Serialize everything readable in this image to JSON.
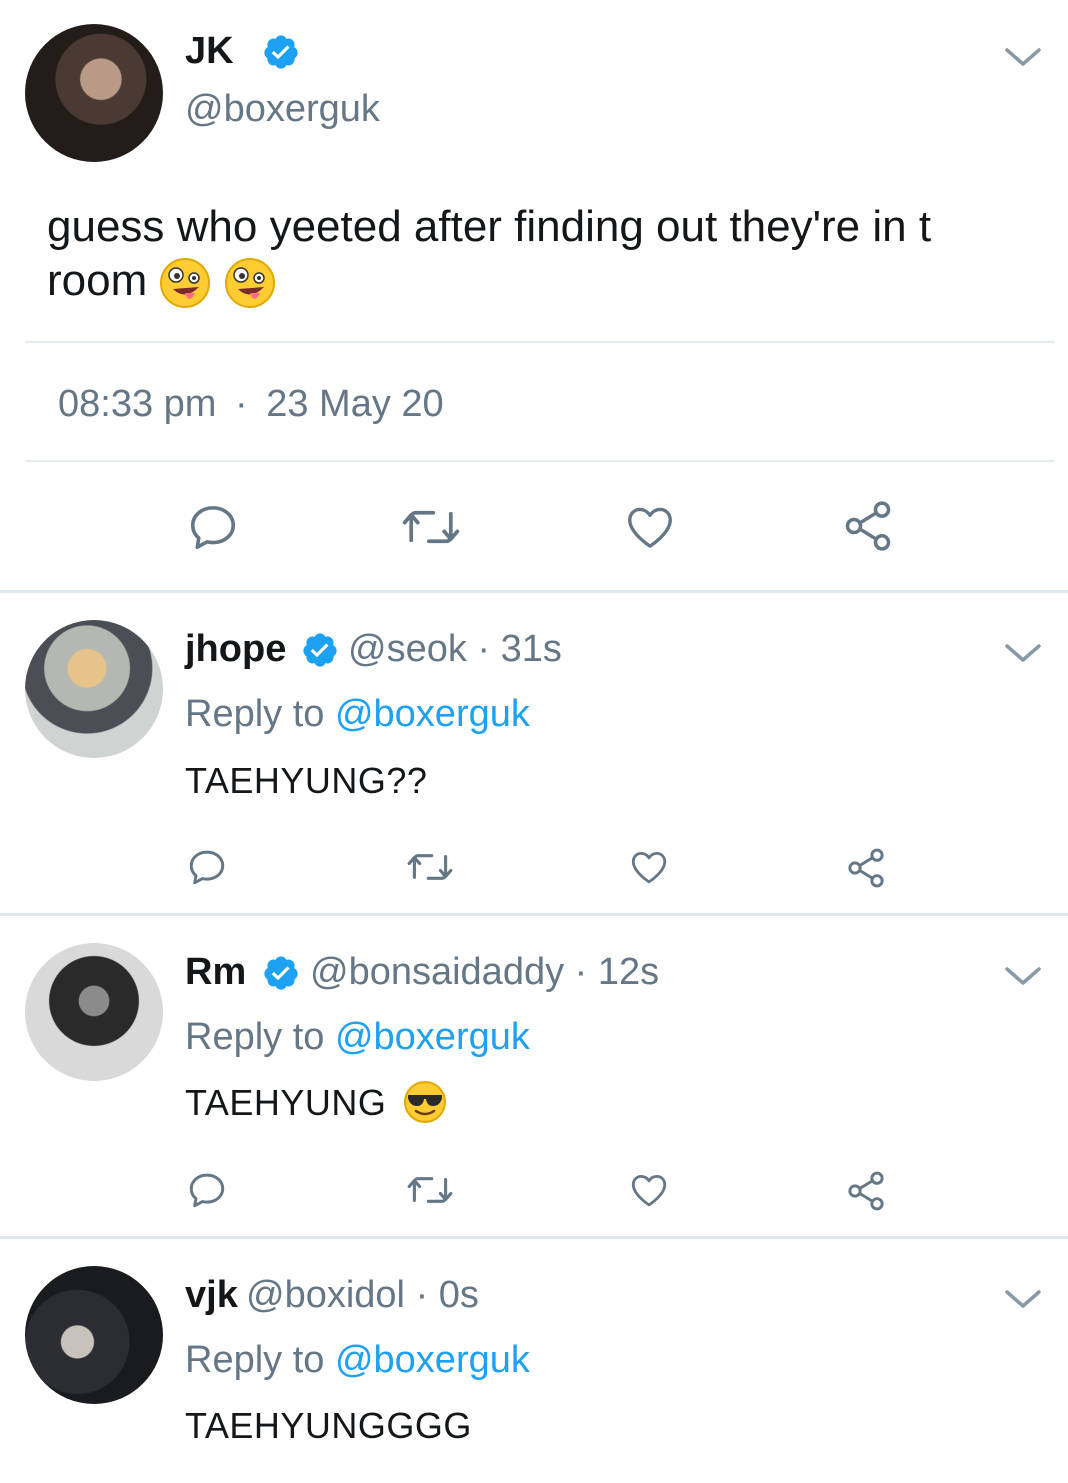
{
  "main_tweet": {
    "name": "JK",
    "handle": "@boxerguk",
    "text": "guess who yeeted after finding out they're in t room",
    "time": "08:33 pm",
    "separator": "·",
    "date": "23 May 20",
    "emojis": [
      "zany-face-emoji",
      "zany-face-emoji"
    ]
  },
  "replies": [
    {
      "name": "jhope",
      "verified": true,
      "handle": "@seok",
      "time": "· 31s",
      "reply_prefix": "Reply to ",
      "reply_target": "@boxerguk",
      "text": "TAEHYUNG??"
    },
    {
      "name": "Rm",
      "verified": true,
      "handle": "@bonsaidaddy",
      "time": "· 12s",
      "reply_prefix": "Reply to ",
      "reply_target": "@boxerguk",
      "text": "TAEHYUNG",
      "emoji": "sunglasses-face-emoji"
    },
    {
      "name": "vjk",
      "verified": false,
      "handle": "@boxidol",
      "time": "· 0s",
      "reply_prefix": "Reply to ",
      "reply_target": "@boxerguk",
      "text": "TAEHYUNGGGG"
    }
  ],
  "colors": {
    "verified": "#1da1f2",
    "link": "#1da1f2",
    "secondary_text": "#657786",
    "icon": "#657786",
    "divider": "#e6ecf0"
  },
  "icons": [
    "reply-icon",
    "retweet-icon",
    "like-icon",
    "share-icon",
    "chevron-down-icon",
    "verified-badge-icon"
  ]
}
